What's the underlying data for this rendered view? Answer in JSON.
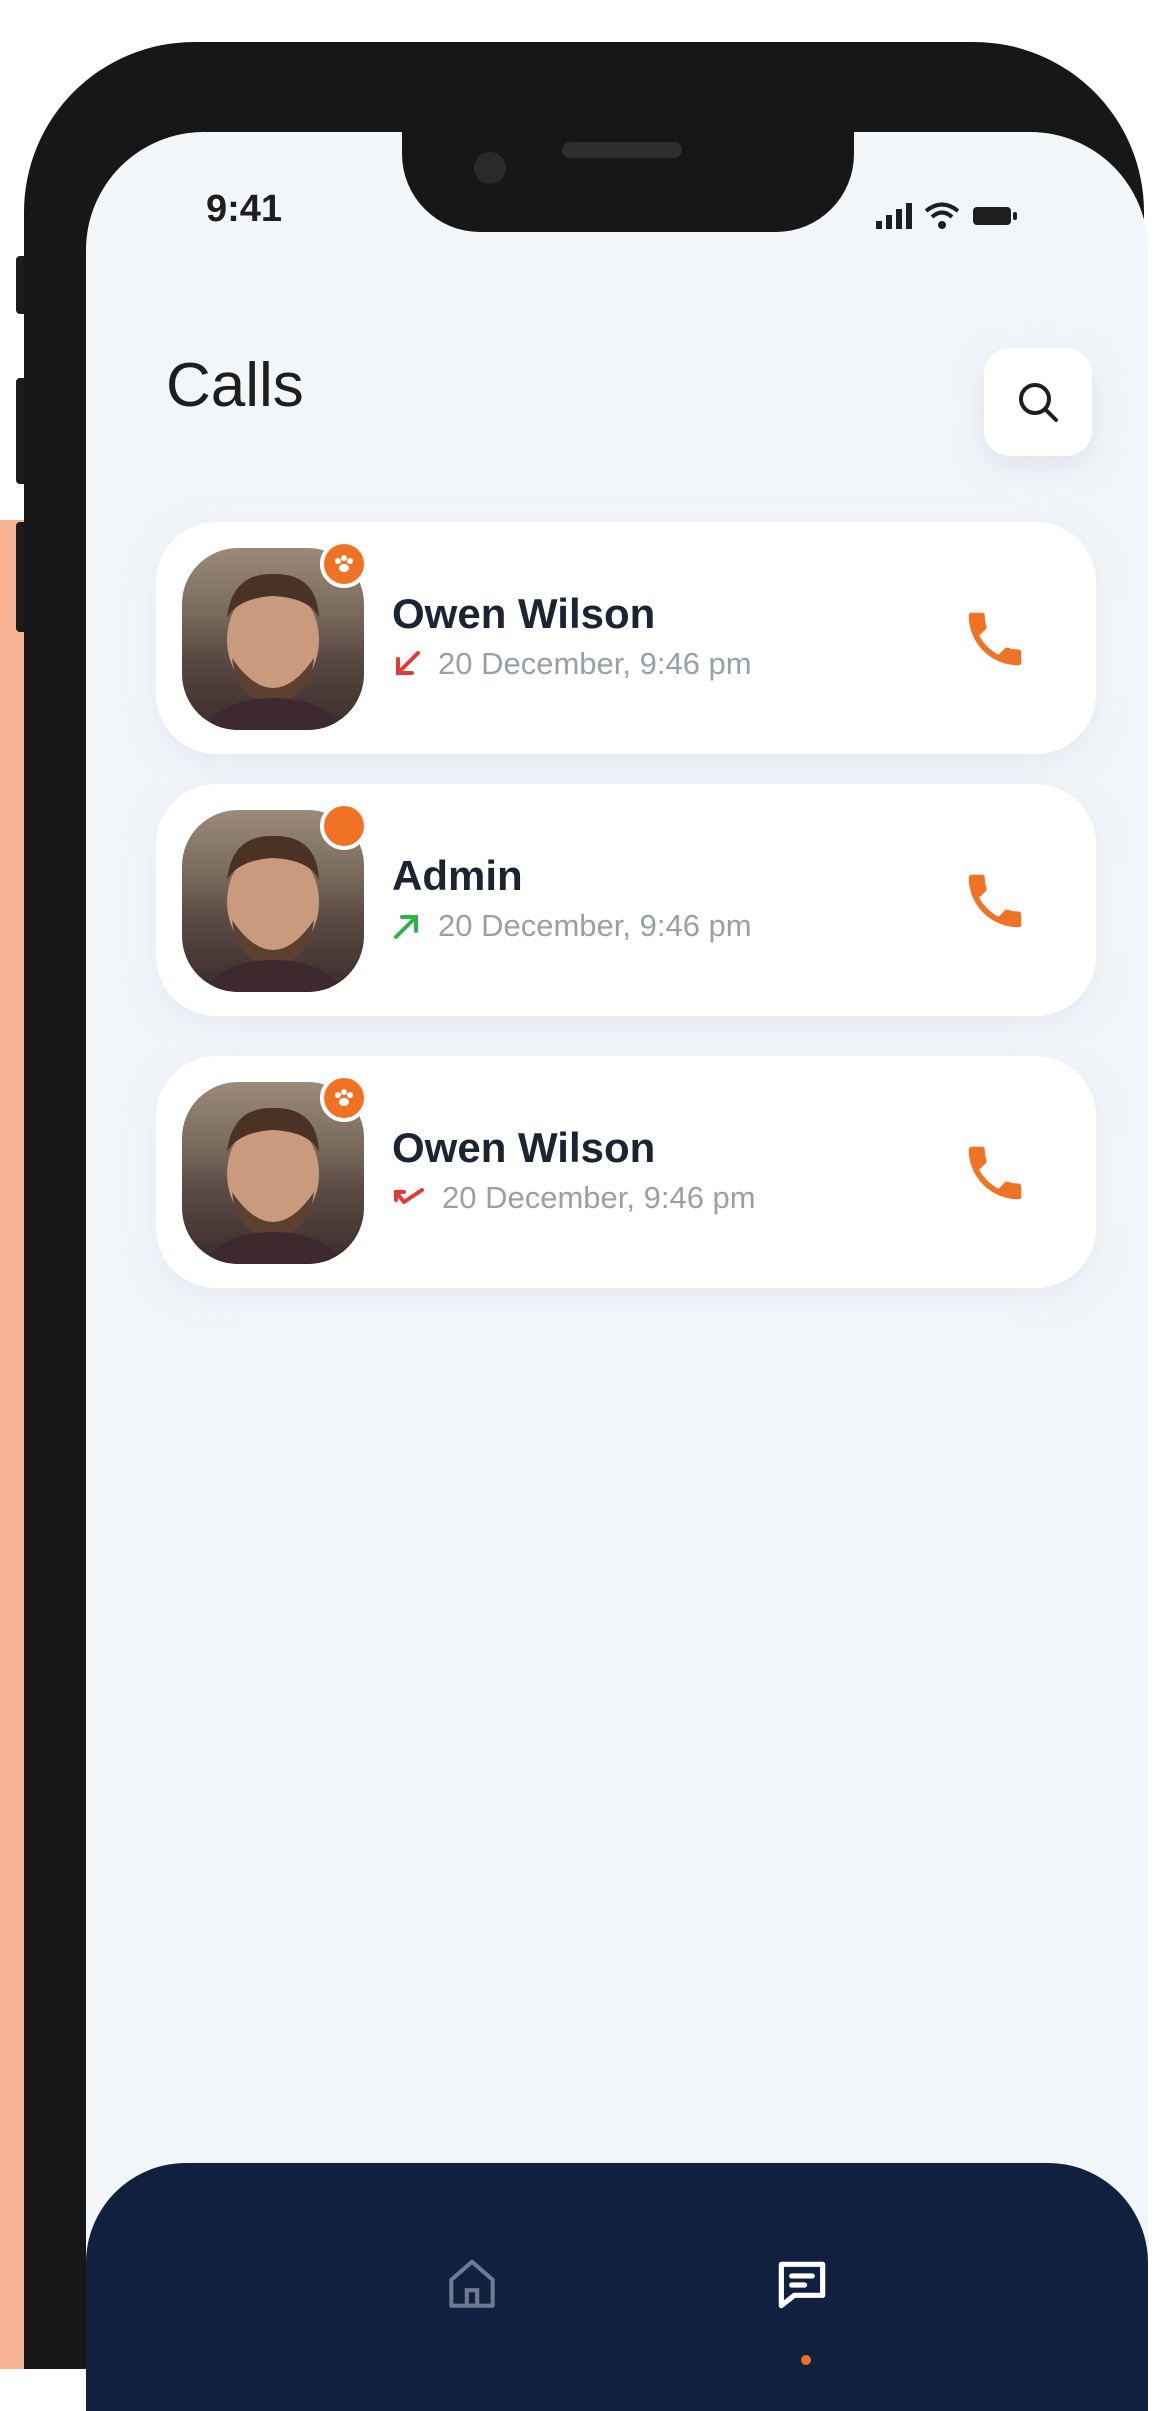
{
  "status_bar": {
    "time": "9:41"
  },
  "header": {
    "title": "Calls"
  },
  "calls": [
    {
      "name": "Owen Wilson",
      "datetime": "20 December, 9:46 pm",
      "direction": "incoming",
      "direction_color": "#E53935",
      "badge": "paw-icon"
    },
    {
      "name": "Admin",
      "datetime": "20 December, 9:46 pm",
      "direction": "outgoing",
      "direction_color": "#2DB34A",
      "badge": "online-dot"
    },
    {
      "name": "Owen Wilson",
      "datetime": "20 December, 9:46 pm",
      "direction": "missed",
      "direction_color": "#E53935",
      "badge": "paw-icon"
    }
  ],
  "bottom_nav": {
    "items": [
      "home-icon",
      "messages-icon"
    ],
    "active": "messages-icon"
  },
  "colors": {
    "accent": "#F07325",
    "nav_bg": "#12203F",
    "screen_bg": "#F3F6F9"
  }
}
